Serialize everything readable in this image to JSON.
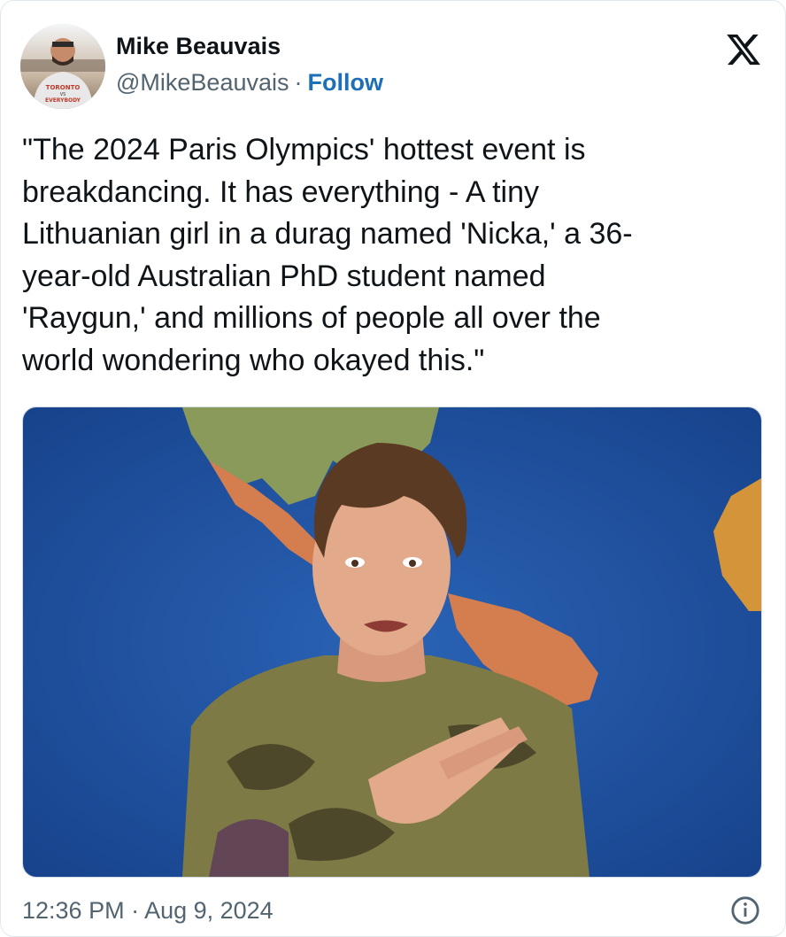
{
  "author": {
    "name": "Mike Beauvais",
    "handle": "@MikeBeauvais",
    "separator": "·",
    "follow_label": "Follow",
    "avatar_shirt_text_top": "TORONTO",
    "avatar_shirt_text_mid": "VS",
    "avatar_shirt_text_bottom": "EVERYBODY"
  },
  "platform_icon": "x-logo-icon",
  "tweet": {
    "text": "\"The 2024 Paris Olympics' hottest event is\nbreakdancing. It has everything - A tiny\nLithuanian girl in a durag named 'Nicka,' a 36-\nyear-old Australian PhD student named\n'Raygun,' and millions of people all over the\nworld wondering who okayed this.\""
  },
  "media": {
    "icon": "photo",
    "colors": {
      "ocean": "#1f56a8",
      "land_green": "#8a9a5a",
      "land_orange": "#d47d4e",
      "shirt": "#7d7a46",
      "skin": "#e2a98a",
      "hair": "#5a3a22"
    }
  },
  "footer": {
    "timestamp": "12:36 PM · Aug 9, 2024",
    "info_icon": "info-circle-icon"
  }
}
